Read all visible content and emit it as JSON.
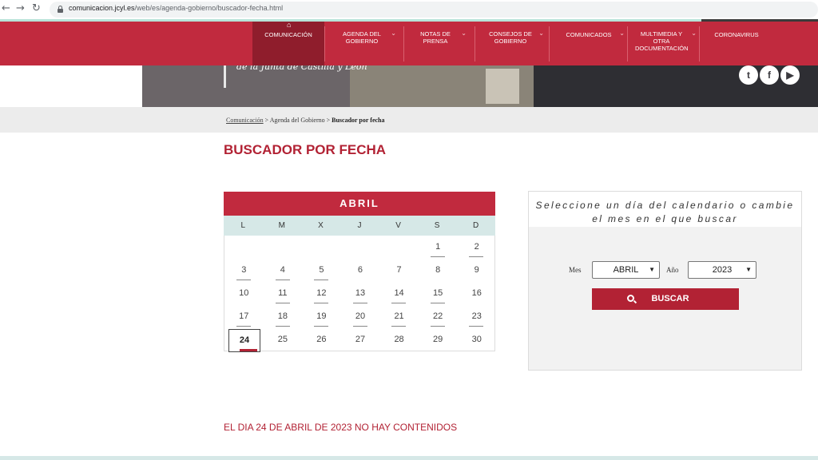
{
  "browser": {
    "back_icon": "←",
    "forward_icon": "→",
    "reload_icon": "↻",
    "url_domain": "comunicacion.jcyl.es",
    "url_path": "/web/es/agenda-gobierno/buscador-fecha.html"
  },
  "nav": {
    "items": [
      {
        "label": "COMUNICACIÓN"
      },
      {
        "label": "AGENDA DEL GOBIERNO"
      },
      {
        "label": "NOTAS DE PRENSA"
      },
      {
        "label": "CONSEJOS DE GOBIERNO"
      },
      {
        "label": "COMUNICADOS"
      },
      {
        "label": "MULTIMEDIA Y OTRA DOCUMENTACIÓN"
      },
      {
        "label": "CORONAVIRUS"
      }
    ]
  },
  "hero": {
    "subtitle": "de la Junta de Castilla y León"
  },
  "breadcrumb": {
    "home": "Comunicación",
    "sep1": ">",
    "level1": "Agenda del Gobierno",
    "sep2": ">",
    "current": "Buscador por fecha"
  },
  "page_title": "BUSCADOR POR FECHA",
  "calendar": {
    "month": "ABRIL",
    "weekdays": [
      "L",
      "M",
      "X",
      "J",
      "V",
      "S",
      "D"
    ],
    "weeks": [
      [
        null,
        null,
        null,
        null,
        null,
        "1",
        "2"
      ],
      [
        "3",
        "4",
        "5",
        "6",
        "7",
        "8",
        "9"
      ],
      [
        "10",
        "11",
        "12",
        "13",
        "14",
        "15",
        "16"
      ],
      [
        "17",
        "18",
        "19",
        "20",
        "21",
        "22",
        "23"
      ],
      [
        "24",
        "25",
        "26",
        "27",
        "28",
        "29",
        "30"
      ]
    ],
    "linked_days": [
      "1",
      "2",
      "3",
      "4",
      "5",
      "11",
      "12",
      "13",
      "14",
      "15",
      "17",
      "18",
      "19",
      "20",
      "21",
      "22",
      "23"
    ],
    "selected_day": "24"
  },
  "search": {
    "instruction": "Seleccione un día del calendario o cambie el mes en el que buscar",
    "month_label": "Mes",
    "month_value": "ABRIL",
    "year_label": "Año",
    "year_value": "2023",
    "button_label": "BUSCAR",
    "button_icon": "search-icon"
  },
  "result_message": "EL DIA 24 DE ABRIL DE 2023 NO HAY CONTENIDOS",
  "colors": {
    "brand_red": "#c12a3e",
    "active_red": "#8f1d2c",
    "title_red": "#b22234",
    "weekday_bg": "#d6e8e7"
  }
}
